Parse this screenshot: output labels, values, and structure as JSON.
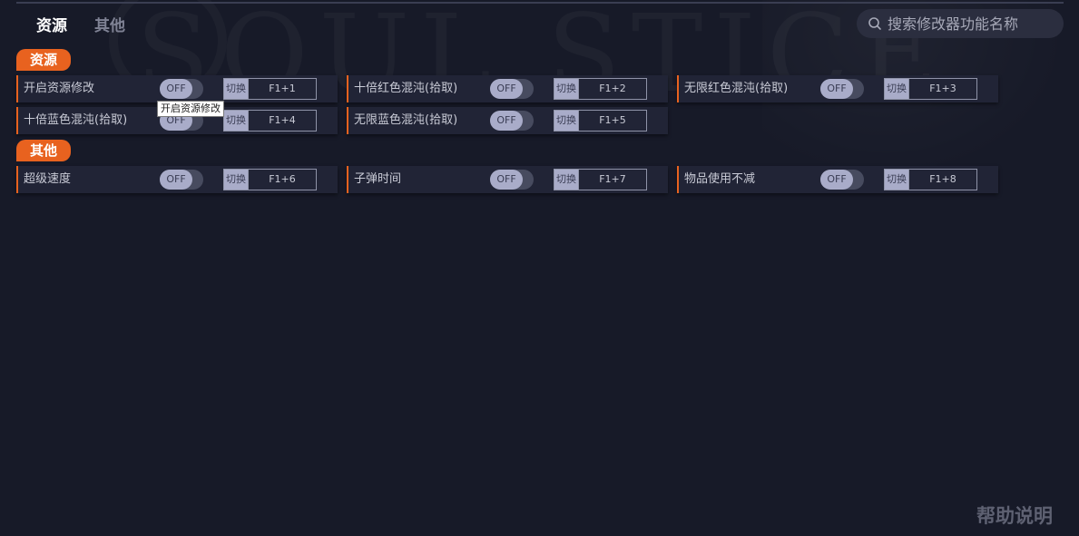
{
  "tabs": [
    {
      "label": "资源",
      "active": true
    },
    {
      "label": "其他",
      "active": false
    }
  ],
  "search": {
    "placeholder": "搜索修改器功能名称",
    "value": "",
    "icon": "search-icon"
  },
  "watermark": {
    "text": "SOUL STICE"
  },
  "colors": {
    "accent": "#e8621f",
    "background": "#171a28",
    "row_background": "#212436",
    "toggle_knob": "#a9acc9"
  },
  "sections": [
    {
      "title": "资源",
      "items": [
        {
          "label": "开启资源修改",
          "state": "OFF",
          "hotkey_label": "切换",
          "hotkey": "F1+1"
        },
        {
          "label": "十倍红色混沌(拾取)",
          "state": "OFF",
          "hotkey_label": "切换",
          "hotkey": "F1+2"
        },
        {
          "label": "无限红色混沌(拾取)",
          "state": "OFF",
          "hotkey_label": "切换",
          "hotkey": "F1+3"
        },
        {
          "label": "十倍蓝色混沌(拾取)",
          "state": "OFF",
          "hotkey_label": "切换",
          "hotkey": "F1+4"
        },
        {
          "label": "无限蓝色混沌(拾取)",
          "state": "OFF",
          "hotkey_label": "切换",
          "hotkey": "F1+5"
        }
      ]
    },
    {
      "title": "其他",
      "items": [
        {
          "label": "超级速度",
          "state": "OFF",
          "hotkey_label": "切换",
          "hotkey": "F1+6"
        },
        {
          "label": "子弹时间",
          "state": "OFF",
          "hotkey_label": "切换",
          "hotkey": "F1+7"
        },
        {
          "label": "物品使用不减",
          "state": "OFF",
          "hotkey_label": "切换",
          "hotkey": "F1+8"
        }
      ]
    }
  ],
  "tooltip": "开启资源修改",
  "help": "帮助说明"
}
